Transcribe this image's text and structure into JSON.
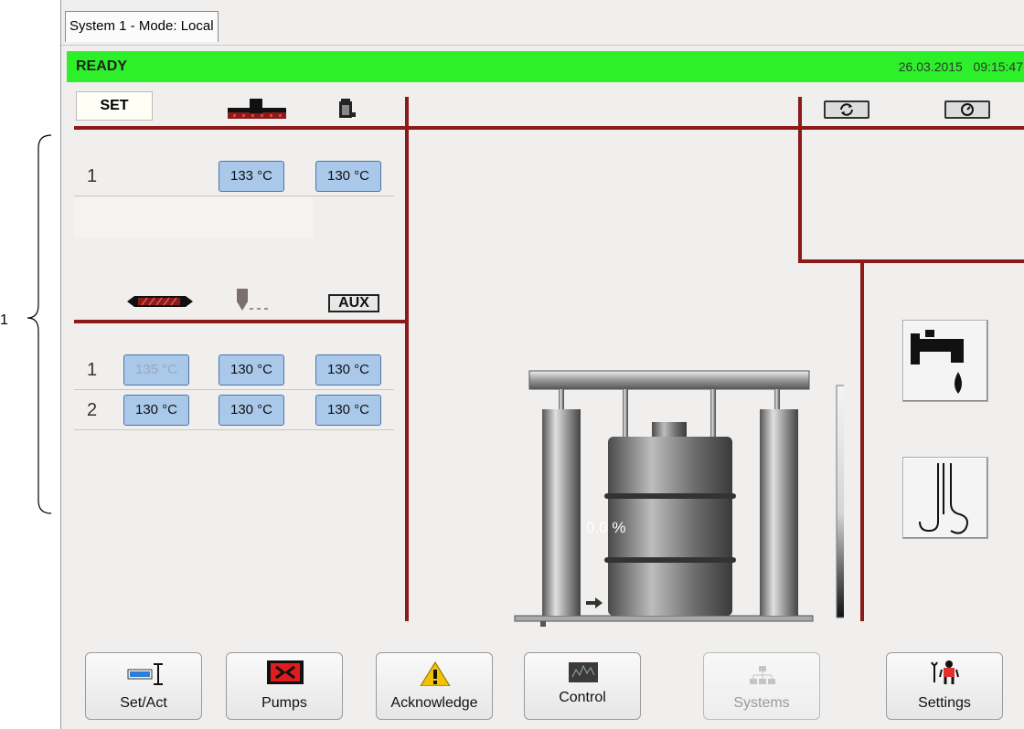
{
  "annotation": {
    "number": "1"
  },
  "tab": {
    "label": "System 1 - Mode: Local"
  },
  "status": {
    "state": "READY",
    "datetime": "26.03.2015   09:15:47",
    "color": "#2ef02a"
  },
  "header": {
    "set_label": "SET",
    "icons": [
      "hose-icon",
      "melt-tank-icon"
    ]
  },
  "upper_table": {
    "rows": [
      {
        "num": "1",
        "values": [
          "133 °C",
          "130 °C"
        ]
      }
    ]
  },
  "lower_header": {
    "icons": [
      "heated-hose-icon",
      "nozzle-icon"
    ],
    "aux_label": "AUX"
  },
  "lower_table": {
    "rows": [
      {
        "num": "1",
        "values": [
          "135 °C",
          "130 °C",
          "130 °C"
        ]
      },
      {
        "num": "2",
        "values": [
          "130 °C",
          "130 °C",
          "130 °C"
        ]
      }
    ]
  },
  "top_buttons": {
    "refresh_icon": "refresh-icon",
    "timer_icon": "timer-icon"
  },
  "side_buttons": [
    "tap-icon",
    "hook-icon"
  ],
  "drum": {
    "fill_percent": "0.0 %"
  },
  "nav": {
    "set_act": "Set/Act",
    "pumps": "Pumps",
    "acknowledge": "Acknowledge",
    "control": "Control",
    "systems": "Systems",
    "settings": "Settings"
  },
  "colors": {
    "accent_line": "#8b1a1a",
    "temp_field": "#a9c8ea"
  }
}
